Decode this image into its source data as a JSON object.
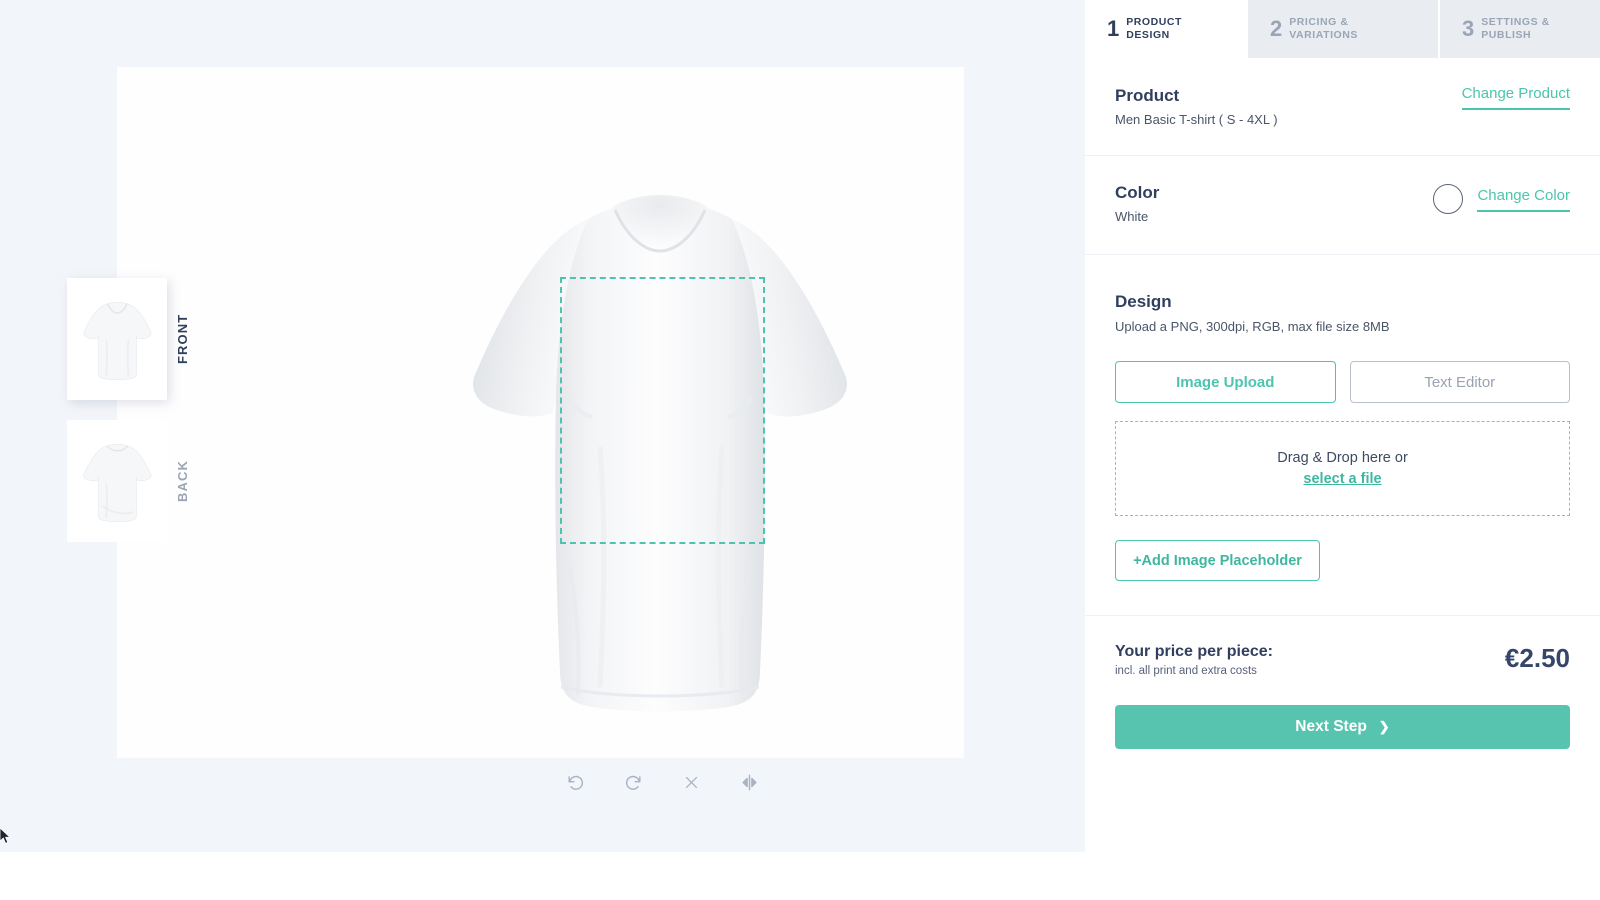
{
  "steps": [
    {
      "num": "1",
      "line1": "PRODUCT",
      "line2": "DESIGN",
      "active": true
    },
    {
      "num": "2",
      "line1": "PRICING &",
      "line2": "VARIATIONS",
      "active": false
    },
    {
      "num": "3",
      "line1": "SETTINGS &",
      "line2": "PUBLISH",
      "active": false
    }
  ],
  "product": {
    "title": "Product",
    "name": "Men Basic T-shirt  ( S - 4XL )",
    "change_label": "Change Product"
  },
  "color": {
    "title": "Color",
    "name": "White",
    "change_label": "Change Color",
    "swatch_hex": "#FFFFFF"
  },
  "design": {
    "title": "Design",
    "subtitle": "Upload a PNG, 300dpi, RGB, max file size 8MB",
    "image_upload_label": "Image Upload",
    "text_editor_label": "Text Editor",
    "dropzone_text": "Drag & Drop here or",
    "dropzone_link": "select a file",
    "add_placeholder_label": "+Add Image Placeholder"
  },
  "price": {
    "label": "Your price per piece:",
    "note": "incl. all print and extra costs",
    "value": "€2.50"
  },
  "next": {
    "label": "Next Step",
    "chevron": "❯"
  },
  "views": [
    {
      "label": "FRONT",
      "active": true
    },
    {
      "label": "BACK",
      "active": false
    }
  ],
  "canvas_tools": [
    {
      "name": "undo",
      "title": "Undo"
    },
    {
      "name": "redo",
      "title": "Redo"
    },
    {
      "name": "delete",
      "title": "Delete"
    },
    {
      "name": "mirror",
      "title": "Mirror"
    }
  ],
  "colors": {
    "accent_teal": "#4CC4AE",
    "accent_teal_button": "#56C4AE",
    "text_navy": "#313F5E",
    "text_muted": "#9AA5B6",
    "workspace_bg": "#F2F5F9",
    "tab_inactive_bg": "#E9EDF1"
  }
}
